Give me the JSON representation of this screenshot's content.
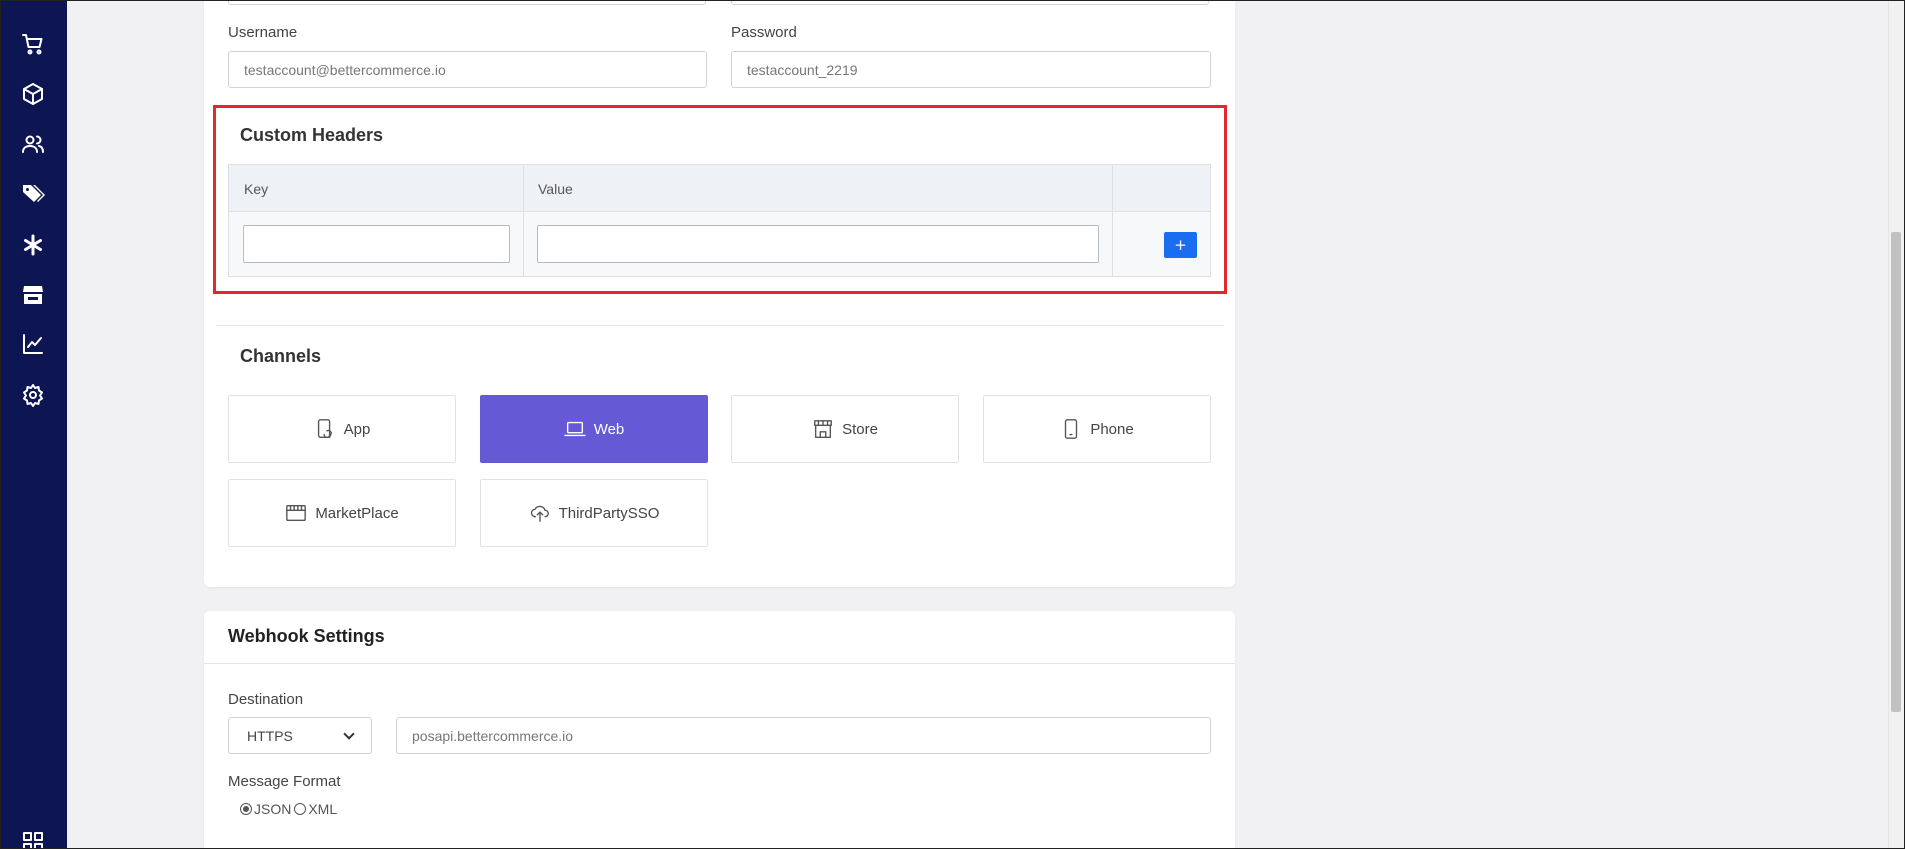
{
  "form": {
    "username_label": "Username",
    "username_value": "testaccount@bettercommerce.io",
    "password_label": "Password",
    "password_value": "testaccount_2219"
  },
  "custom_headers": {
    "title": "Custom Headers",
    "columns": [
      "Key",
      "Value"
    ],
    "add_label": "+"
  },
  "channels": {
    "title": "Channels",
    "items": [
      {
        "label": "App",
        "icon": "app-icon",
        "active": false
      },
      {
        "label": "Web",
        "icon": "laptop-icon",
        "active": true
      },
      {
        "label": "Store",
        "icon": "store-icon",
        "active": false
      },
      {
        "label": "Phone",
        "icon": "phone-icon",
        "active": false
      },
      {
        "label": "MarketPlace",
        "icon": "marketplace-icon",
        "active": false
      },
      {
        "label": "ThirdPartySSO",
        "icon": "cloud-icon",
        "active": false
      }
    ]
  },
  "webhook": {
    "title": "Webhook Settings",
    "destination_label": "Destination",
    "protocol": "HTTPS",
    "destination_value": "posapi.bettercommerce.io",
    "format_label": "Message Format",
    "formats": [
      "JSON",
      "XML"
    ],
    "selected_format": "JSON"
  },
  "sidebar": {
    "icons": [
      "cart-icon",
      "box-icon",
      "users-icon",
      "tags-icon",
      "asterisk-icon",
      "store-icon",
      "chart-icon",
      "gear-icon",
      "grid-icon"
    ]
  },
  "colors": {
    "sidebar": "#0e1553",
    "active_channel": "#6659d6",
    "add_button": "#1a6cf0",
    "highlight": "#e0282e"
  }
}
